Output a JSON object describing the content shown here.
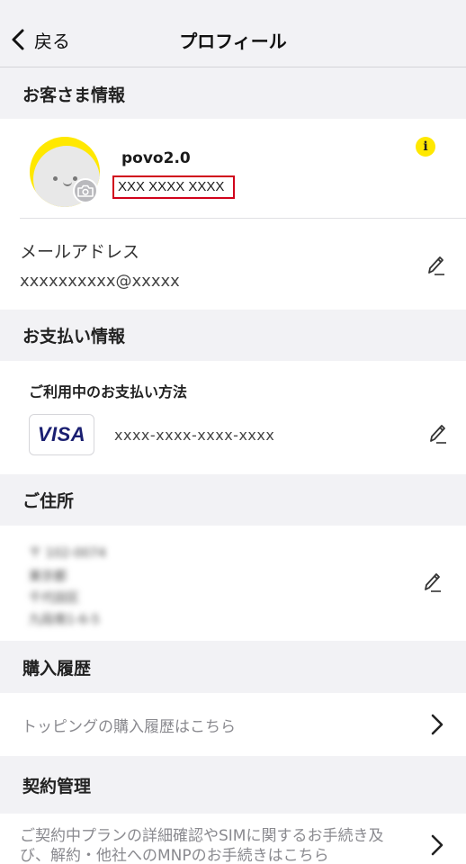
{
  "nav": {
    "back_label": "戻る",
    "title": "プロフィール"
  },
  "customer": {
    "header": "お客さま情報",
    "name": "povo2.0",
    "phone": "XXX XXXX XXXX",
    "info_glyph": "i",
    "email_label": "メールアドレス",
    "email_value": "xxxxxxxxxx@xxxxx"
  },
  "payment": {
    "header": "お支払い情報",
    "method_label": "ご利用中のお支払い方法",
    "card_brand": "VISA",
    "card_number": "xxxx-xxxx-xxxx-xxxx"
  },
  "address": {
    "header": "ご住所",
    "lines": [
      "〒 102-0074",
      "東京都",
      "千代田区",
      "九段南1-6-5"
    ]
  },
  "purchase": {
    "header": "購入履歴",
    "link": "トッピングの購入履歴はこちら"
  },
  "contract": {
    "header": "契約管理",
    "link_line1": "ご契約中プランの詳細確認やSIMに関するお手続き及",
    "link_line2": "び、解約・他社へのMNPのお手続きはこちら"
  },
  "colors": {
    "accent": "#ffe800",
    "highlight_border": "#d0021b",
    "visa_blue": "#1a1f71",
    "background": "#f2f2f5"
  },
  "icons": [
    "chevron-left-icon",
    "info-icon",
    "camera-icon",
    "pencil-icon",
    "chevron-right-icon"
  ]
}
